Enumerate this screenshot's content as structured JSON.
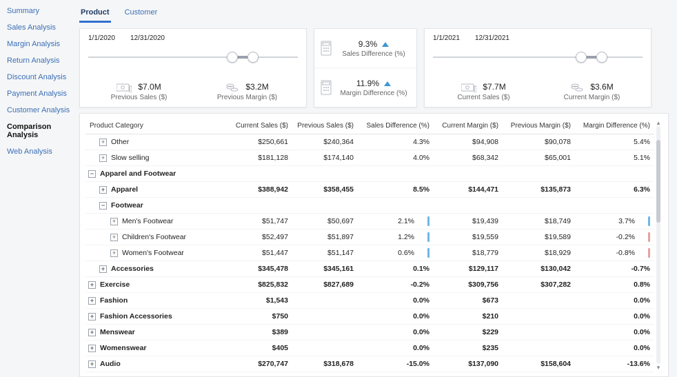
{
  "sidebar": {
    "items": [
      {
        "label": "Summary"
      },
      {
        "label": "Sales Analysis"
      },
      {
        "label": "Margin Analysis"
      },
      {
        "label": "Return Analysis"
      },
      {
        "label": "Discount Analysis"
      },
      {
        "label": "Payment Analysis"
      },
      {
        "label": "Customer Analysis"
      },
      {
        "label": "Comparison Analysis"
      },
      {
        "label": "Web Analysis"
      }
    ],
    "active_index": 7
  },
  "tabs": {
    "items": [
      {
        "label": "Product"
      },
      {
        "label": "Customer"
      }
    ],
    "active_index": 0
  },
  "range_prev": {
    "from": "1/1/2020",
    "to": "12/31/2020",
    "sales": {
      "value": "$7.0M",
      "label": "Previous Sales ($)"
    },
    "margin": {
      "value": "$3.2M",
      "label": "Previous Margin ($)"
    }
  },
  "diff": {
    "sales": {
      "value": "9.3%",
      "label": "Sales Difference (%)",
      "dir": "up"
    },
    "margin": {
      "value": "11.9%",
      "label": "Margin Difference (%)",
      "dir": "up"
    }
  },
  "range_curr": {
    "from": "1/1/2021",
    "to": "12/31/2021",
    "sales": {
      "value": "$7.7M",
      "label": "Current Sales ($)"
    },
    "margin": {
      "value": "$3.6M",
      "label": "Current Margin ($)"
    }
  },
  "table": {
    "headers": [
      "Product Category",
      "Current Sales ($)",
      "Previous Sales ($)",
      "Sales Difference (%)",
      "Current Margin ($)",
      "Previous Margin ($)",
      "Margin Difference (%)"
    ],
    "rows": [
      {
        "indent": 1,
        "exp": "+",
        "label": "Other",
        "cs": "$250,661",
        "ps": "$240,364",
        "sd": "4.3%",
        "cm": "$94,908",
        "pm": "$90,078",
        "md": "5.4%"
      },
      {
        "indent": 1,
        "exp": "+",
        "label": "Slow selling",
        "cs": "$181,128",
        "ps": "$174,140",
        "sd": "4.0%",
        "cm": "$68,342",
        "pm": "$65,001",
        "md": "5.1%"
      },
      {
        "indent": 0,
        "exp": "-",
        "label": "Apparel and Footwear",
        "group": true
      },
      {
        "indent": 1,
        "exp": "+",
        "label": "Apparel",
        "bold": true,
        "cs": "$388,942",
        "ps": "$358,455",
        "sd": "8.5%",
        "cm": "$144,471",
        "pm": "$135,873",
        "md": "6.3%"
      },
      {
        "indent": 1,
        "exp": "-",
        "label": "Footwear",
        "bold": true
      },
      {
        "indent": 2,
        "exp": "+",
        "label": "Men's Footwear",
        "cs": "$51,747",
        "ps": "$50,697",
        "sd": "2.1%",
        "sdbar": "pos",
        "cm": "$19,439",
        "pm": "$18,749",
        "md": "3.7%",
        "mdbar": "pos"
      },
      {
        "indent": 2,
        "exp": "+",
        "label": "Children's Footwear",
        "cs": "$52,497",
        "ps": "$51,897",
        "sd": "1.2%",
        "sdbar": "pos",
        "cm": "$19,559",
        "pm": "$19,589",
        "md": "-0.2%",
        "mdbar": "neg"
      },
      {
        "indent": 2,
        "exp": "+",
        "label": "Women's Footwear",
        "cs": "$51,447",
        "ps": "$51,147",
        "sd": "0.6%",
        "sdbar": "pos",
        "cm": "$18,779",
        "pm": "$18,929",
        "md": "-0.8%",
        "mdbar": "neg"
      },
      {
        "indent": 1,
        "exp": "+",
        "label": "Accessories",
        "bold": true,
        "cs": "$345,478",
        "ps": "$345,161",
        "sd": "0.1%",
        "cm": "$129,117",
        "pm": "$130,042",
        "md": "-0.7%"
      },
      {
        "indent": 0,
        "exp": "+",
        "label": "Exercise",
        "bold": true,
        "cs": "$825,832",
        "ps": "$827,689",
        "sd": "-0.2%",
        "cm": "$309,756",
        "pm": "$307,282",
        "md": "0.8%"
      },
      {
        "indent": 0,
        "exp": "+",
        "label": "Fashion",
        "bold": true,
        "cs": "$1,543",
        "ps": "",
        "sd": "0.0%",
        "cm": "$673",
        "pm": "",
        "md": "0.0%"
      },
      {
        "indent": 0,
        "exp": "+",
        "label": "Fashion Accessories",
        "bold": true,
        "cs": "$750",
        "ps": "",
        "sd": "0.0%",
        "cm": "$210",
        "pm": "",
        "md": "0.0%"
      },
      {
        "indent": 0,
        "exp": "+",
        "label": "Menswear",
        "bold": true,
        "cs": "$389",
        "ps": "",
        "sd": "0.0%",
        "cm": "$229",
        "pm": "",
        "md": "0.0%"
      },
      {
        "indent": 0,
        "exp": "+",
        "label": "Womenswear",
        "bold": true,
        "cs": "$405",
        "ps": "",
        "sd": "0.0%",
        "cm": "$235",
        "pm": "",
        "md": "0.0%"
      },
      {
        "indent": 0,
        "exp": "+",
        "label": "Audio",
        "bold": true,
        "cs": "$270,747",
        "ps": "$318,678",
        "sd": "-15.0%",
        "cm": "$137,090",
        "pm": "$158,604",
        "md": "-13.6%"
      }
    ]
  }
}
